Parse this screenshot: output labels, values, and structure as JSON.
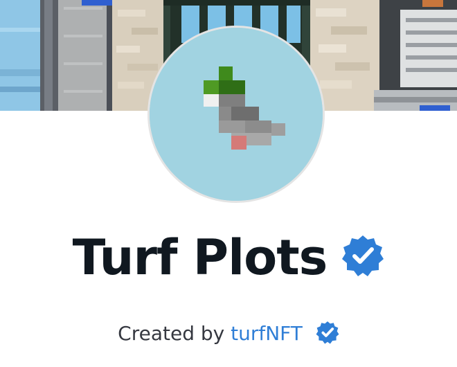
{
  "collection": {
    "title": "Turf Plots",
    "verified_icon": "verified-badge-icon"
  },
  "creator": {
    "prefix": "Created by",
    "name": "turfNFT",
    "verified_icon": "verified-badge-icon"
  },
  "colors": {
    "title": "#101820",
    "creator_prefix": "#353840",
    "creator_link": "#2f7ed6",
    "verified_badge": "#2f7ed6",
    "avatar_background": "#a1d3e1"
  }
}
